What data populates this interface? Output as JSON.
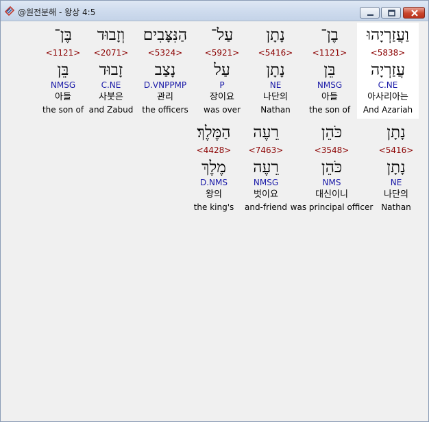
{
  "window": {
    "title": "@원전분해 - 왕상 4:5",
    "minimize_label": "minimize-icon",
    "maximize_label": "maximize-icon",
    "close_label": "close-icon"
  },
  "colors": {
    "strong_number": "#8b0000",
    "parsing": "#1a1aa8",
    "selected_bg": "#ffffff"
  },
  "words": [
    {
      "hebrew": "וַעֲזַרְיָהוּ",
      "strong": "<5838>",
      "lemma": "עֲזַרְיָה",
      "parsing": "C.NE",
      "korean": "아사리아는",
      "english": "And Azariah",
      "selected": true
    },
    {
      "hebrew": "בֶן־",
      "strong": "<1121>",
      "lemma": "בֵּן",
      "parsing": "NMSG",
      "korean": "아들",
      "english": "the son of",
      "selected": false
    },
    {
      "hebrew": "נָתָן",
      "strong": "<5416>",
      "lemma": "נָתָן",
      "parsing": "NE",
      "korean": "나단의",
      "english": "Nathan",
      "selected": false
    },
    {
      "hebrew": "עַל־",
      "strong": "<5921>",
      "lemma": "עַל",
      "parsing": "P",
      "korean": "장이요",
      "english": "was over",
      "selected": false
    },
    {
      "hebrew": "הַנִּצָּבִים",
      "strong": "<5324>",
      "lemma": "נָצַב",
      "parsing": "D.VNPPMP",
      "korean": "관리",
      "english": "the officers",
      "selected": false
    },
    {
      "hebrew": "וְזָבוּד",
      "strong": "<2071>",
      "lemma": "זָבוּד",
      "parsing": "C.NE",
      "korean": "사붓은",
      "english": "and Zabud",
      "selected": false
    },
    {
      "hebrew": "בֶּן־",
      "strong": "<1121>",
      "lemma": "בֵּן",
      "parsing": "NMSG",
      "korean": "아들",
      "english": "the son of",
      "selected": false
    },
    {
      "hebrew": "נָתָן",
      "strong": "<5416>",
      "lemma": "נָתָן",
      "parsing": "NE",
      "korean": "나단의",
      "english": "Nathan",
      "selected": false
    },
    {
      "hebrew": "כֹּהֵן",
      "strong": "<3548>",
      "lemma": "כֹּהֵן",
      "parsing": "NMS",
      "korean": "대신이니",
      "english": "was principal officer",
      "selected": false
    },
    {
      "hebrew": "רֵעֶה",
      "strong": "<7463>",
      "lemma": "רֵעֶה",
      "parsing": "NMSG",
      "korean": "벗이요",
      "english": "and-friend",
      "selected": false
    },
    {
      "hebrew": "הַמֶּלֶךְ׃",
      "strong": "<4428>",
      "lemma": "מֶלֶךְ",
      "parsing": "D.NMS",
      "korean": "왕의",
      "english": "the king's",
      "selected": false
    }
  ]
}
